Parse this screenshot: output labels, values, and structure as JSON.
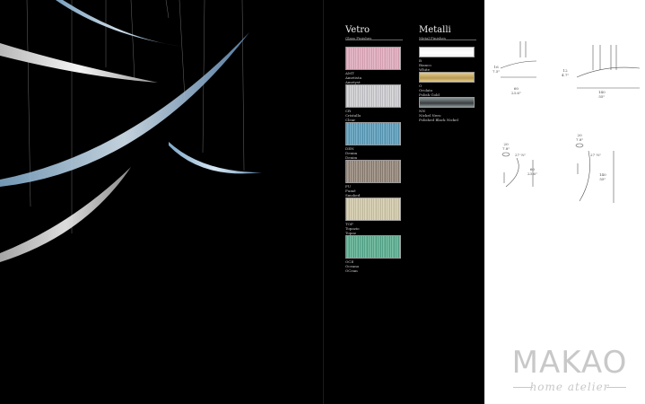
{
  "vetro": {
    "title": "Vetro",
    "subtitle": "Glass Finishes"
  },
  "metalli": {
    "title": "Metalli",
    "subtitle": "Metal Finishes"
  },
  "glass_finishes": [
    {
      "label": "AMT\nAmetista\nAmetyst",
      "color_a": "#c98fa3",
      "color_b": "#f0cad6"
    },
    {
      "label": "CR\nCristallo\nClear",
      "color_a": "#a9a9ad",
      "color_b": "#ececef"
    },
    {
      "label": "DEN\nDenim\nDenim",
      "color_a": "#3f7e9c",
      "color_b": "#8fc4dc"
    },
    {
      "label": "FU\nFumé\nSmoked",
      "color_a": "#6f6258",
      "color_b": "#c2b6aa"
    },
    {
      "label": "TOP\nTopazio\nTopaz",
      "color_a": "#b3ab8f",
      "color_b": "#ebe4c9"
    },
    {
      "label": "OCE\nOceano\nOCean",
      "color_a": "#3b8e74",
      "color_b": "#8fd1b6"
    }
  ],
  "metal_finishes": [
    {
      "label": "B\nBianco\nWhite",
      "color_a": "#ffffff",
      "color_b": "#f2f2f2"
    },
    {
      "label": "O\nOrolato\nPolish Gold",
      "color_a": "#b89a54",
      "color_b": "#e2cd8e"
    },
    {
      "label": "NN\nNickel Nero\nPolished Black Nickel",
      "color_a": "#3a3f40",
      "color_b": "#8b9597"
    }
  ],
  "dimensions": {
    "d1_height": "16\n7.5\"",
    "d1_width": "60\n23.6\"",
    "d2_height": "12\n4.7\"",
    "d2_width": "140\n55\"",
    "d3_top": "20\n7.8\"",
    "d3_side": "27 ⅝\"",
    "d3_height": "60\n23.6\"",
    "d4_top": "20\n7.8\"",
    "d4_side": "27 ⅝\"",
    "d4_height": "140\n55\""
  },
  "brand": {
    "name": "MAKAO",
    "tagline": "home atelier"
  }
}
